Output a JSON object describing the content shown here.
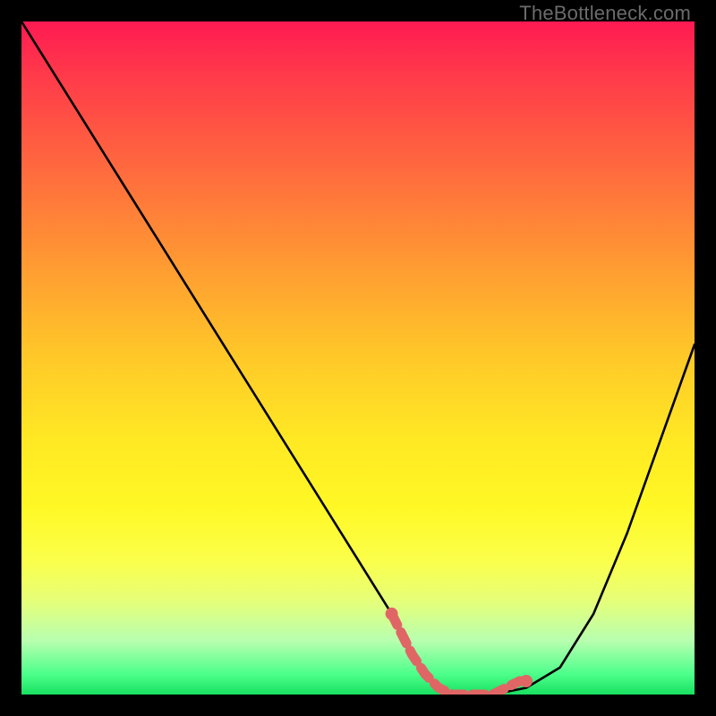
{
  "watermark": "TheBottleneck.com",
  "colors": {
    "frame_bg": "#000000",
    "gradient_top": "#ff1a52",
    "gradient_mid": "#ffe824",
    "gradient_bottom": "#18e060",
    "curve": "#000000",
    "marker": "#e06666"
  },
  "chart_data": {
    "type": "line",
    "title": "",
    "xlabel": "",
    "ylabel": "",
    "xlim": [
      0,
      100
    ],
    "ylim": [
      0,
      100
    ],
    "grid": false,
    "series": [
      {
        "name": "curve",
        "x": [
          0,
          5,
          10,
          15,
          20,
          25,
          30,
          35,
          40,
          45,
          50,
          55,
          58,
          60,
          62,
          65,
          68,
          70,
          75,
          80,
          85,
          90,
          95,
          100
        ],
        "values": [
          100,
          92,
          84,
          76,
          68,
          60,
          52,
          44,
          36,
          28,
          20,
          12,
          6,
          3,
          1,
          0,
          0,
          0,
          1,
          4,
          12,
          24,
          38,
          52
        ]
      }
    ],
    "markers": {
      "name": "highlighted-range",
      "x": [
        55,
        56,
        58,
        60,
        62,
        64,
        66,
        68,
        70,
        72,
        74,
        75
      ],
      "values": [
        12,
        10,
        6,
        3,
        1,
        0,
        0,
        0,
        0,
        1,
        2,
        2
      ]
    },
    "legend": false
  }
}
